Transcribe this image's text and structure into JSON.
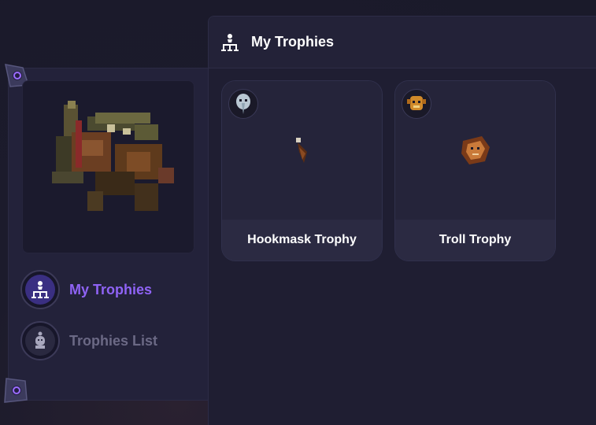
{
  "header": {
    "title": "My Trophies"
  },
  "nav": {
    "items": [
      {
        "label": "My Trophies",
        "active": true
      },
      {
        "label": "Trophies List",
        "active": false
      }
    ]
  },
  "trophies": [
    {
      "name": "Hookmask Trophy"
    },
    {
      "name": "Troll Trophy"
    }
  ],
  "colors": {
    "accent": "#8f63f5",
    "inactive": "#6b6985",
    "panel": "#23223a"
  }
}
